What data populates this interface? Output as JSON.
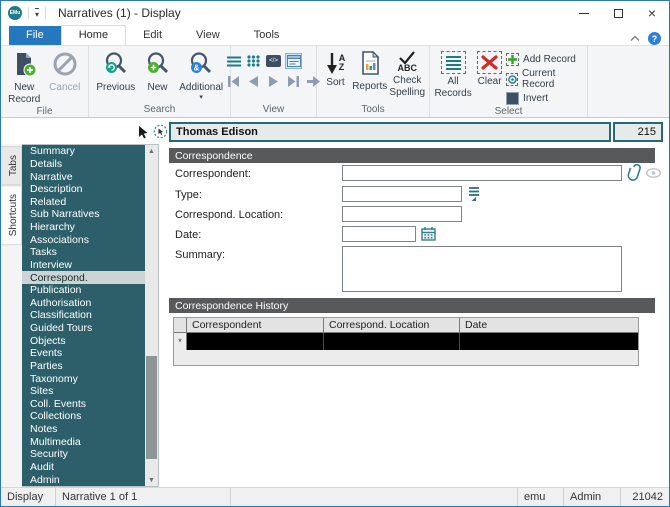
{
  "window": {
    "logo_text": "EMu",
    "title": "Narratives (1) - Display"
  },
  "tabs": {
    "items": [
      "File",
      "Home",
      "Edit",
      "View",
      "Tools"
    ],
    "active": "Home"
  },
  "ribbon": {
    "file_group": {
      "label": "File",
      "new_record": "New Record",
      "cancel": "Cancel"
    },
    "search_group": {
      "label": "Search",
      "previous": "Previous",
      "new": "New",
      "additional": "Additional"
    },
    "view_group": {
      "label": "View",
      "code_glyph": "</>"
    },
    "tools_group": {
      "label": "Tools",
      "sort": "Sort",
      "reports": "Reports",
      "check_spelling": "Check Spelling",
      "sort_a": "A",
      "sort_z": "Z",
      "abc": "ABC"
    },
    "select_group": {
      "label": "Select",
      "all_records": "All Records",
      "clear": "Clear",
      "add_record": "Add Record",
      "current_record": "Current Record",
      "invert": "Invert"
    }
  },
  "record_bar": {
    "name": "Thomas Edison",
    "number": "215"
  },
  "side_tabs": {
    "tabs_label": "Tabs",
    "shortcuts_label": "Shortcuts"
  },
  "sidebar": {
    "selected": "Correspond.",
    "items": [
      "Summary",
      "Details",
      "Narrative",
      "Description",
      "Related",
      "Sub Narratives",
      "Hierarchy",
      "Associations",
      "Tasks",
      "Interview",
      "Correspond.",
      "Publication",
      "Authorisation",
      "Classification",
      "Guided Tours",
      "Objects",
      "Events",
      "Parties",
      "Taxonomy",
      "Sites",
      "Coll. Events",
      "Collections",
      "Notes",
      "Multimedia",
      "Security",
      "Audit",
      "Admin"
    ]
  },
  "form": {
    "correspondence_header": "Correspondence",
    "fields": {
      "correspondent_label": "Correspondent:",
      "correspondent_value": "",
      "type_label": "Type:",
      "type_value": "",
      "location_label": "Correspond. Location:",
      "location_value": "",
      "date_label": "Date:",
      "date_value": "",
      "summary_label": "Summary:",
      "summary_value": ""
    },
    "history_header": "Correspondence History",
    "history_table": {
      "columns": [
        "Correspondent",
        "Correspond. Location",
        "Date"
      ],
      "new_row_marker": "*",
      "rows": []
    }
  },
  "statusbar": {
    "mode": "Display",
    "record_count": "Narrative 1 of 1",
    "db": "emu",
    "user": "Admin",
    "number": "21042"
  },
  "colors": {
    "accent_blue": "#2577be",
    "icon_teal": "#1f7a8c",
    "sidebar_teal": "#2d5f6b",
    "section_header_gray": "#58595b",
    "selected_row": "#000000"
  }
}
